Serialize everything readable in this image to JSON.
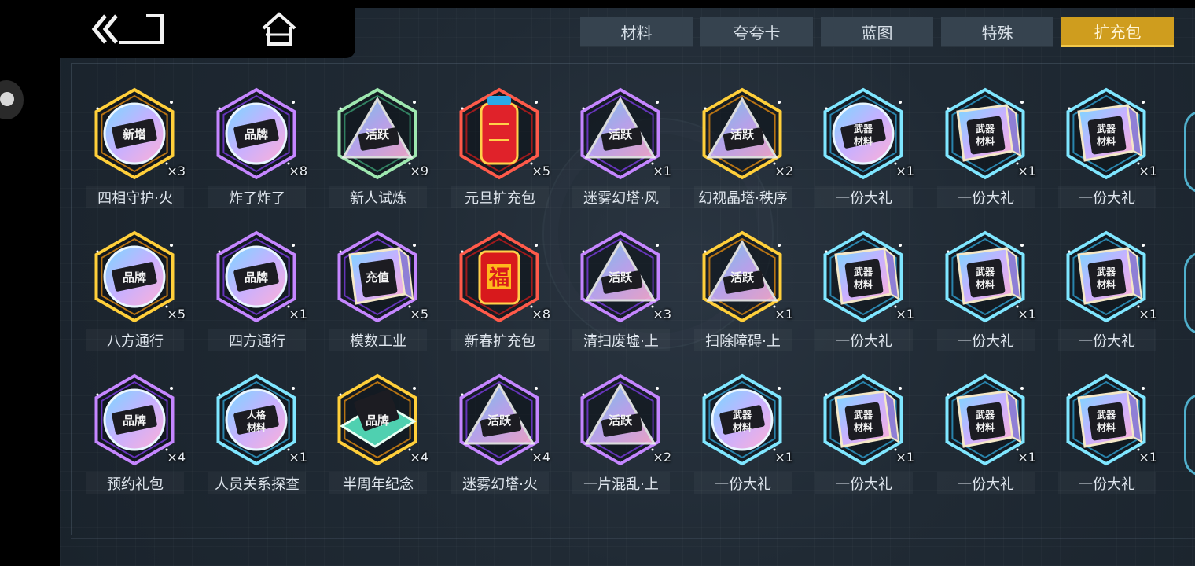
{
  "nav": {
    "back_icon": "double-chevron-left-icon",
    "home_icon": "home-icon"
  },
  "tabs": [
    {
      "label": "材料",
      "active": false
    },
    {
      "label": "夸夸卡",
      "active": false
    },
    {
      "label": "蓝图",
      "active": false
    },
    {
      "label": "特殊",
      "active": false
    },
    {
      "label": "扩充包",
      "active": true
    }
  ],
  "colors": {
    "active_tab": "#cf9d1e",
    "inactive_tab": "#36434f",
    "gold_frame": "#f0a020",
    "purple_frame": "#9a5cf0",
    "cyan_frame": "#4fc8e6",
    "red_lantern": "#e0222a"
  },
  "items": [
    [
      {
        "name": "四相守护·火",
        "count": "×3",
        "icon": "coin-badge-icon",
        "badge": "新增",
        "frame": "gold"
      },
      {
        "name": "炸了炸了",
        "count": "×8",
        "icon": "coin-badge-icon",
        "badge": "品牌",
        "frame": "purple"
      },
      {
        "name": "新人试炼",
        "count": "×9",
        "icon": "triangle-pack-icon",
        "badge": "活跃",
        "frame": "green"
      },
      {
        "name": "元旦扩充包",
        "count": "×5",
        "icon": "lantern-icon",
        "badge": "",
        "frame": "red"
      },
      {
        "name": "迷雾幻塔·风",
        "count": "×1",
        "icon": "triangle-pack-icon",
        "badge": "活跃",
        "frame": "purple"
      },
      {
        "name": "幻视晶塔·秩序",
        "count": "×2",
        "icon": "triangle-pack-icon",
        "badge": "活跃",
        "frame": "gold"
      },
      {
        "name": "一份大礼",
        "count": "×1",
        "icon": "coin-badge-icon",
        "badge": "武器材料",
        "frame": "cyan"
      },
      {
        "name": "一份大礼",
        "count": "×1",
        "icon": "cube-pack-icon",
        "badge": "武器材料",
        "frame": "cyan"
      },
      {
        "name": "一份大礼",
        "count": "×1",
        "icon": "cube-pack-icon",
        "badge": "武器材料",
        "frame": "cyan"
      }
    ],
    [
      {
        "name": "八方通行",
        "count": "×5",
        "icon": "coin-badge-icon",
        "badge": "品牌",
        "frame": "gold"
      },
      {
        "name": "四方通行",
        "count": "×1",
        "icon": "coin-badge-icon",
        "badge": "品牌",
        "frame": "purple"
      },
      {
        "name": "模数工业",
        "count": "×5",
        "icon": "cube-pack-icon",
        "badge": "充值",
        "frame": "purple"
      },
      {
        "name": "新春扩充包",
        "count": "×8",
        "icon": "firecracker-icon",
        "badge": "福",
        "frame": "red"
      },
      {
        "name": "清扫废墟·上",
        "count": "×3",
        "icon": "triangle-pack-icon",
        "badge": "活跃",
        "frame": "purple"
      },
      {
        "name": "扫除障碍·上",
        "count": "×1",
        "icon": "triangle-pack-icon",
        "badge": "活跃",
        "frame": "gold"
      },
      {
        "name": "一份大礼",
        "count": "×1",
        "icon": "cube-pack-icon",
        "badge": "武器材料",
        "frame": "cyan"
      },
      {
        "name": "一份大礼",
        "count": "×1",
        "icon": "cube-pack-icon",
        "badge": "武器材料",
        "frame": "cyan"
      },
      {
        "name": "一份大礼",
        "count": "×1",
        "icon": "cube-pack-icon",
        "badge": "武器材料",
        "frame": "cyan"
      }
    ],
    [
      {
        "name": "预约礼包",
        "count": "×4",
        "icon": "coin-badge-icon",
        "badge": "品牌",
        "frame": "purple"
      },
      {
        "name": "人员关系探查",
        "count": "×1",
        "icon": "coin-badge-icon",
        "badge": "人格材料",
        "frame": "cyan"
      },
      {
        "name": "半周年纪念",
        "count": "×4",
        "icon": "card-pack-icon",
        "badge": "品牌",
        "frame": "gold"
      },
      {
        "name": "迷雾幻塔·火",
        "count": "×4",
        "icon": "triangle-pack-icon",
        "badge": "活跃",
        "frame": "purple"
      },
      {
        "name": "一片混乱·上",
        "count": "×2",
        "icon": "triangle-pack-icon",
        "badge": "活跃",
        "frame": "purple"
      },
      {
        "name": "一份大礼",
        "count": "×1",
        "icon": "coin-badge-icon",
        "badge": "武器材料",
        "frame": "cyan"
      },
      {
        "name": "一份大礼",
        "count": "×1",
        "icon": "cube-pack-icon",
        "badge": "武器材料",
        "frame": "cyan"
      },
      {
        "name": "一份大礼",
        "count": "×1",
        "icon": "cube-pack-icon",
        "badge": "武器材料",
        "frame": "cyan"
      },
      {
        "name": "一份大礼",
        "count": "×1",
        "icon": "cube-pack-icon",
        "badge": "武器材料",
        "frame": "cyan"
      }
    ]
  ]
}
